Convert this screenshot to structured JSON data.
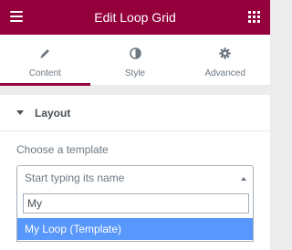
{
  "header": {
    "title": "Edit Loop Grid",
    "menu_icon": "hamburger-icon",
    "widgets_icon": "grid-icon"
  },
  "tabs": [
    {
      "label": "Content",
      "icon": "pencil-icon",
      "active": true
    },
    {
      "label": "Style",
      "icon": "half-circle-icon",
      "active": false
    },
    {
      "label": "Advanced",
      "icon": "gear-icon",
      "active": false
    }
  ],
  "section": {
    "title": "Layout"
  },
  "template_field": {
    "label": "Choose a template",
    "placeholder": "Start typing its name",
    "search_value": "My",
    "options": [
      "My Loop (Template)"
    ]
  },
  "colors": {
    "brand": "#93003c",
    "highlight": "#5897fb"
  }
}
